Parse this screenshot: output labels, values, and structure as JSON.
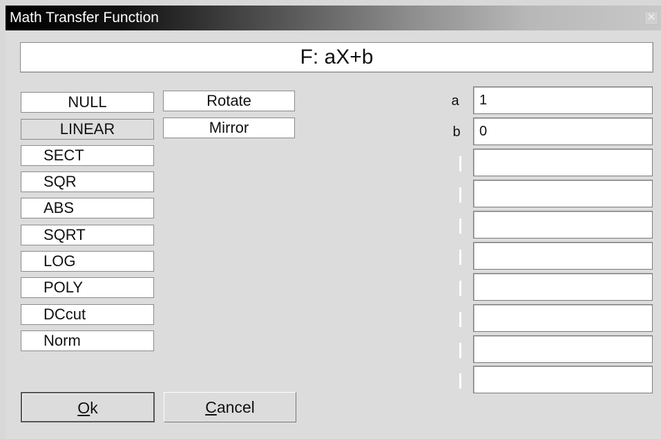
{
  "window": {
    "title": "Math Transfer Function",
    "close_glyph": "✕"
  },
  "formula": "F: aX+b",
  "functions": [
    "NULL",
    "LINEAR",
    "SECT",
    "SQR",
    "ABS",
    "SQRT",
    "LOG",
    "POLY",
    "DCcut",
    "Norm"
  ],
  "selected_function": "LINEAR",
  "operations": [
    "Rotate",
    "Mirror"
  ],
  "params": [
    {
      "label": "a",
      "value": "1"
    },
    {
      "label": "b",
      "value": "0"
    },
    {
      "label": "",
      "value": ""
    },
    {
      "label": "",
      "value": ""
    },
    {
      "label": "",
      "value": ""
    },
    {
      "label": "",
      "value": ""
    },
    {
      "label": "",
      "value": ""
    },
    {
      "label": "",
      "value": ""
    },
    {
      "label": "",
      "value": ""
    },
    {
      "label": "",
      "value": ""
    }
  ],
  "buttons": {
    "ok": {
      "mnemonic": "O",
      "rest": "k"
    },
    "cancel": {
      "mnemonic": "C",
      "rest": "ancel"
    }
  }
}
